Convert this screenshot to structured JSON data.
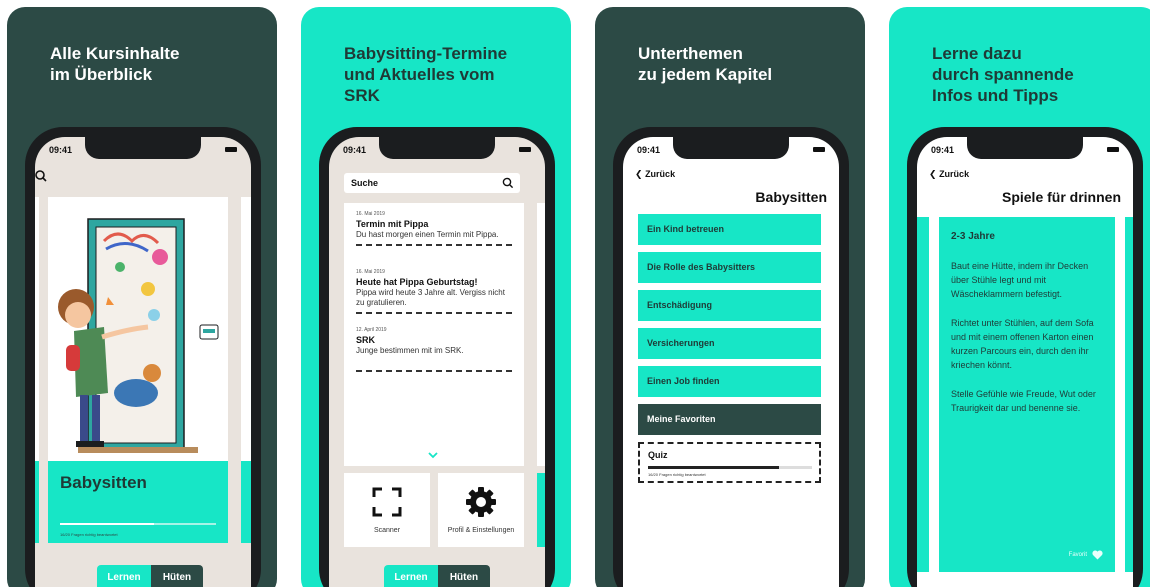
{
  "colors": {
    "teal": "#17e6c6",
    "dark": "#2c4a45"
  },
  "status_time": "09:41",
  "panels": [
    {
      "headline": [
        "Alle Kursinhalte",
        "im Überblick"
      ],
      "card_title": "Babysitten",
      "progress_text": "16/20 Fragen richtig beantwortet",
      "progress_fraction": 0.6,
      "tabs": [
        "Lernen",
        "Hüten"
      ]
    },
    {
      "headline": [
        "Babysitting-Termine",
        "und Aktuelles vom",
        "SRK"
      ],
      "search_label": "Suche",
      "news": [
        {
          "date": "16. Mai 2019",
          "title": "Termin mit Pippa",
          "body": "Du hast morgen einen Termin mit Pippa."
        },
        {
          "date": "16. Mai 2019",
          "title": "Heute hat Pippa Geburtstag!",
          "body": "Pippa wird heute 3 Jahre alt. Vergiss nicht zu gratulieren."
        },
        {
          "date": "12. April 2019",
          "title": "SRK",
          "body": "Junge bestimmen mit im SRK."
        }
      ],
      "tiles": [
        "Scanner",
        "Profil & Einstellungen"
      ],
      "tabs": [
        "Lernen",
        "Hüten"
      ]
    },
    {
      "headline": [
        "Unterthemen",
        "zu jedem Kapitel"
      ],
      "back_label": "Zurück",
      "title": "Babysitten",
      "chapters": [
        "Ein Kind betreuen",
        "Die Rolle des Babysitters",
        "Entschädigung",
        "Versicherungen",
        "Einen Job finden",
        "Meine Favoriten"
      ],
      "quiz_title": "Quiz",
      "quiz_progress_text": "16/20 Fragen richtig beantwortet",
      "quiz_fraction": 0.8
    },
    {
      "headline": [
        "Lerne dazu",
        "durch spannende",
        "Infos und Tipps"
      ],
      "back_label": "Zurück",
      "title": "Spiele für drinnen",
      "card_heading": "2-3 Jahre",
      "paragraphs": [
        "Baut eine Hütte, indem ihr Decken über Stühle legt und mit Wäscheklammern befestigt.",
        "Richtet unter Stühlen, auf dem Sofa und mit einem offenen Karton einen kurzen Parcours ein, durch den ihr kriechen könnt.",
        "Stelle Gefühle wie Freude, Wut oder Traurigkeit dar und benenne sie."
      ],
      "favorite_label": "Favorit"
    }
  ]
}
